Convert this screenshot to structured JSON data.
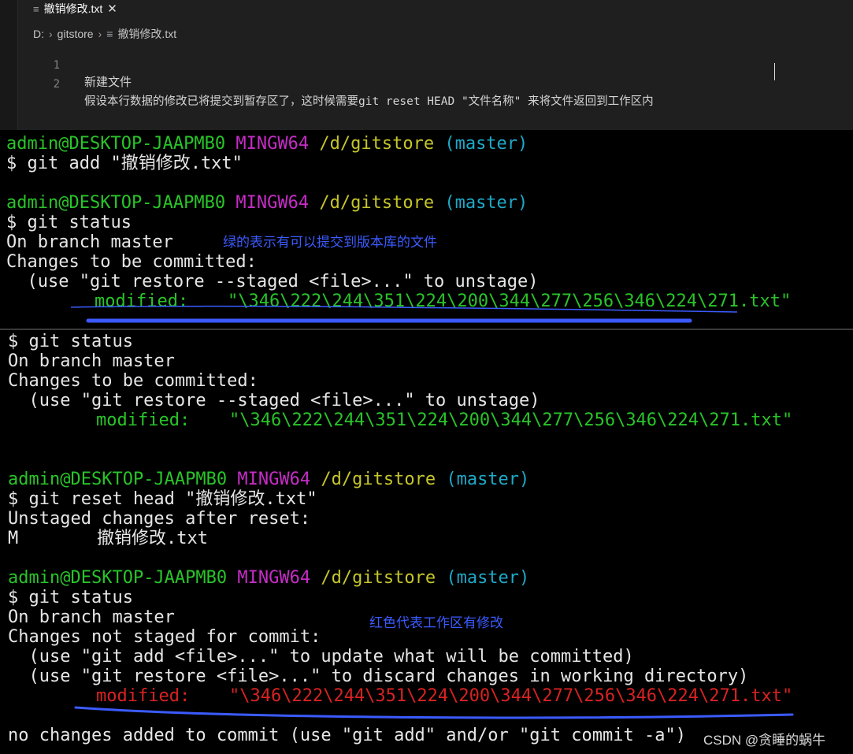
{
  "editor": {
    "tab_label": "撤销修改.txt",
    "breadcrumb": [
      "D:",
      "gitstore",
      "撤销修改.txt"
    ],
    "lines": [
      {
        "no": "1",
        "text": "新建文件"
      },
      {
        "no": "2",
        "text": "假设本行数据的修改已将提交到暂存区了，这时候需要git reset HEAD \"文件名称\" 来将文件返回到工作区内"
      }
    ]
  },
  "terminal": {
    "prompt_user": "admin@DESKTOP-JAAPMB0",
    "prompt_env": "MINGW64",
    "prompt_path": "/d/gitstore",
    "prompt_branch": "(master)",
    "cmd_add": "$ git add \"撤销修改.txt\"",
    "cmd_status": "$ git status",
    "on_branch": "On branch master",
    "changes_committed": "Changes to be committed:",
    "use_restore_staged": "  (use \"git restore --staged <file>...\" to unstage)",
    "modified_label": "modified:",
    "modified_file": "\"\\346\\222\\244\\351\\224\\200\\344\\277\\256\\346\\224\\271.txt\"",
    "cmd_reset": "$ git reset head \"撤销修改.txt\"",
    "unstaged_after_reset": "Unstaged changes after reset:",
    "m_flag": "M",
    "m_file": "撤销修改.txt",
    "changes_not_staged": "Changes not staged for commit:",
    "use_add": "  (use \"git add <file>...\" to update what will be committed)",
    "use_restore": "  (use \"git restore <file>...\" to discard changes in working directory)",
    "no_changes": "no changes added to commit (use \"git add\" and/or \"git commit -a\")"
  },
  "annotations": {
    "green_note": "绿的表示有可以提交到版本库的文件",
    "red_note": "红色代表工作区有修改",
    "watermark": "CSDN @贪睡的蜗牛"
  },
  "colors": {
    "green": "#29c429",
    "magenta": "#c62cc6",
    "yellow": "#c6c62a",
    "cyan": "#1ea9c9",
    "red": "#d82222",
    "annotation_blue": "#3b5bff"
  }
}
